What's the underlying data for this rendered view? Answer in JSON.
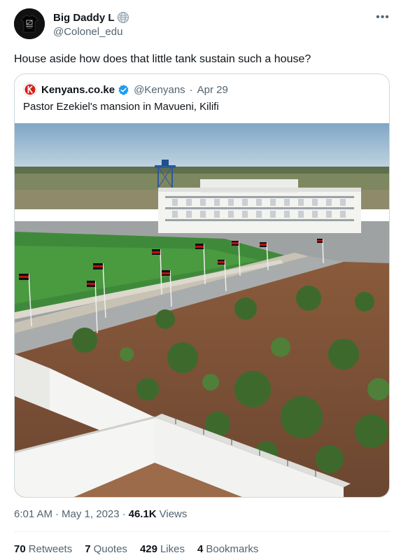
{
  "author": {
    "display_name": "Big Daddy L",
    "handle": "@Colonel_edu",
    "badge_icon": "globe-icon"
  },
  "tweet": {
    "text": "House aside how does that little tank sustain such a house?"
  },
  "quoted": {
    "name": "Kenyans.co.ke",
    "handle": "@Kenyans",
    "separator": "·",
    "date": "Apr 29",
    "text": "Pastor Ezekiel's mansion in Mavueni, Kilifi",
    "logo_color": "#d91e18",
    "verified_color": "#1d9bf0"
  },
  "meta": {
    "time": "6:01 AM",
    "separator1": "·",
    "date": "May 1, 2023",
    "separator2": "·",
    "views_count": "46.1K",
    "views_label": "Views"
  },
  "stats": [
    {
      "count": "70",
      "label": "Retweets"
    },
    {
      "count": "7",
      "label": "Quotes"
    },
    {
      "count": "429",
      "label": "Likes"
    },
    {
      "count": "4",
      "label": "Bookmarks"
    }
  ],
  "colors": {
    "text_primary": "#0f1419",
    "text_secondary": "#536471",
    "border": "#cfd9de"
  }
}
